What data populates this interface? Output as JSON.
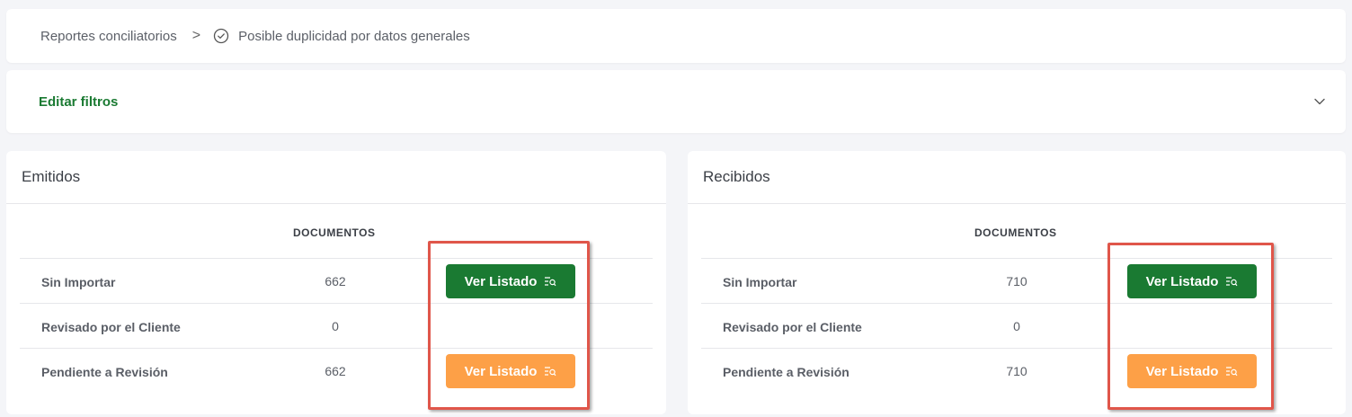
{
  "breadcrumb": {
    "parent": "Reportes conciliatorios",
    "separator": ">",
    "current": "Posible duplicidad por datos generales"
  },
  "filters": {
    "label": "Editar filtros"
  },
  "panels": {
    "emitidos": {
      "title": "Emitidos",
      "column_header": "DOCUMENTOS",
      "rows": [
        {
          "label": "Sin Importar",
          "count": "662",
          "button": "Ver Listado"
        },
        {
          "label": "Revisado por el Cliente",
          "count": "0"
        },
        {
          "label": "Pendiente a Revisión",
          "count": "662",
          "button": "Ver Listado"
        }
      ]
    },
    "recibidos": {
      "title": "Recibidos",
      "column_header": "DOCUMENTOS",
      "rows": [
        {
          "label": "Sin Importar",
          "count": "710",
          "button": "Ver Listado"
        },
        {
          "label": "Revisado por el Cliente",
          "count": "0"
        },
        {
          "label": "Pendiente a Revisión",
          "count": "710",
          "button": "Ver Listado"
        }
      ]
    }
  },
  "colors": {
    "primary_green": "#1a7a32",
    "warning_orange": "#fda047",
    "highlight_red": "#e0564a"
  },
  "icons": {
    "breadcrumb_status": "check-circle-icon",
    "filters_toggle": "chevron-down-icon",
    "button": "list-search-icon"
  }
}
